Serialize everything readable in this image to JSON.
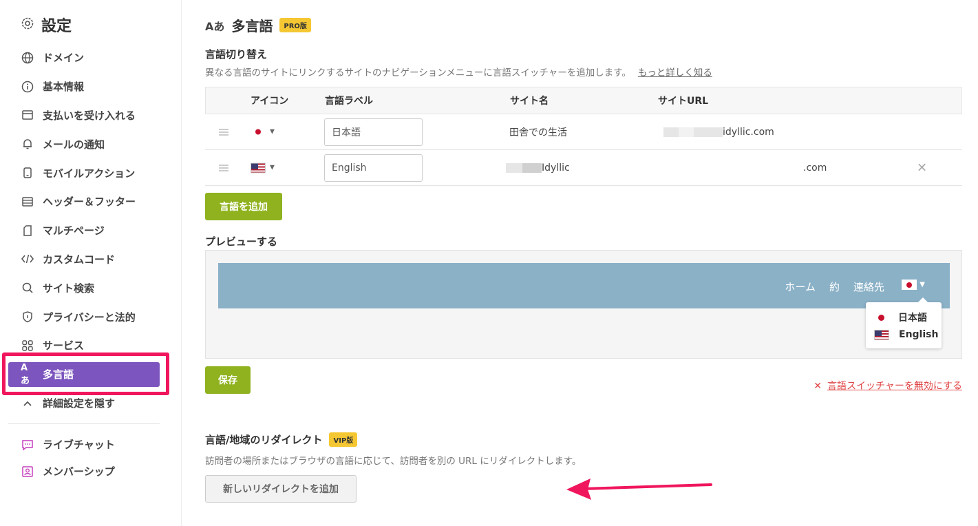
{
  "sidebar": {
    "title": "設定",
    "items": [
      {
        "label": "ドメイン",
        "icon": "globe-icon"
      },
      {
        "label": "基本情報",
        "icon": "info-icon"
      },
      {
        "label": "支払いを受け入れる",
        "icon": "payment-icon"
      },
      {
        "label": "メールの通知",
        "icon": "bell-icon"
      },
      {
        "label": "モバイルアクション",
        "icon": "mobile-icon"
      },
      {
        "label": "ヘッダー＆フッター",
        "icon": "header-footer-icon"
      },
      {
        "label": "マルチページ",
        "icon": "page-icon"
      },
      {
        "label": "カスタムコード",
        "icon": "code-icon"
      },
      {
        "label": "サイト検索",
        "icon": "search-icon"
      },
      {
        "label": "プライバシーと法的",
        "icon": "shield-icon"
      },
      {
        "label": "サービス",
        "icon": "grid-icon"
      },
      {
        "label": "多言語",
        "icon": "language-icon",
        "icon_text": "Aあ",
        "active": true
      },
      {
        "label": "詳細設定を隠す",
        "icon": "chevron-up-icon"
      }
    ],
    "extra": [
      {
        "label": "ライブチャット",
        "icon": "chat-icon"
      },
      {
        "label": "メンバーシップ",
        "icon": "member-icon"
      }
    ]
  },
  "header": {
    "icon_text": "Aあ",
    "title": "多言語",
    "badge": "PRO版"
  },
  "switcher": {
    "title": "言語切り替え",
    "description": "異なる言語のサイトにリンクするサイトのナビゲーションメニューに言語スイッチャーを追加します。",
    "learn_more": "もっと詳しく知る",
    "columns": {
      "icon": "アイコン",
      "label": "言語ラベル",
      "site_name": "サイト名",
      "site_url": "サイトURL"
    },
    "rows": [
      {
        "flag": "jp",
        "label": "日本語",
        "site_name": "田舎での生活",
        "site_url": "idyllic.com"
      },
      {
        "flag": "us",
        "label": "English",
        "site_name": "Idyllic",
        "site_url": ".com"
      }
    ],
    "add_button": "言語を追加"
  },
  "preview": {
    "title": "プレビューする",
    "nav": [
      "ホーム",
      "約",
      "連絡先"
    ],
    "dropdown": [
      "日本語",
      "English"
    ]
  },
  "save_button": "保存",
  "disable_link": "言語スイッチャーを無効にする",
  "redirect": {
    "title": "言語/地域のリダイレクト",
    "badge": "VIP版",
    "description": "訪問者の場所またはブラウザの言語に応じて、訪問者を別の URL にリダイレクトします。",
    "add_button": "新しいリダイレクトを追加"
  },
  "colors": {
    "accent": "#7c55be",
    "green": "#8fb21e",
    "highlight": "#f0165d",
    "preview_bar": "#8bb1c7"
  }
}
